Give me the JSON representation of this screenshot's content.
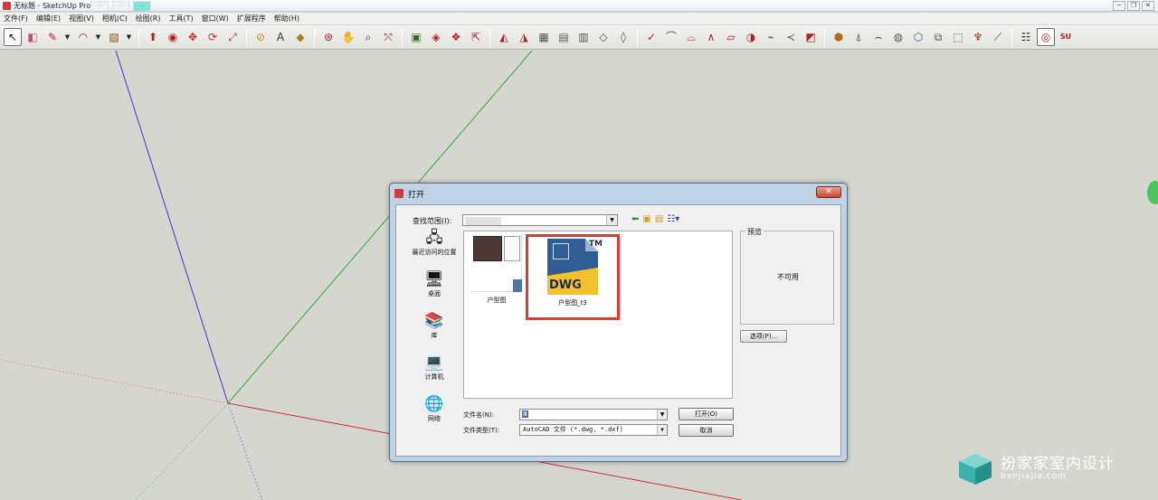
{
  "window": {
    "title": "无标题 - SketchUp Pro",
    "ghost_tabs": [
      "...",
      "...",
      "..."
    ],
    "controls": [
      "─",
      "❐",
      "✕"
    ]
  },
  "menubar": [
    "文件(F)",
    "编辑(E)",
    "视图(V)",
    "相机(C)",
    "绘图(R)",
    "工具(T)",
    "窗口(W)",
    "扩展程序",
    "帮助(H)"
  ],
  "toolbar": {
    "groups": [
      [
        {
          "name": "select",
          "glyph": "↖",
          "color": "#111",
          "active": true
        },
        {
          "name": "eraser",
          "glyph": "◧",
          "color": "#d24b6e"
        },
        {
          "name": "pencil",
          "glyph": "✎",
          "color": "#b32020",
          "drop": true
        },
        {
          "name": "arc",
          "glyph": "◠",
          "color": "#b32020",
          "drop": true
        },
        {
          "name": "rectangle",
          "glyph": "▧",
          "color": "#8a4a2a",
          "drop": true
        }
      ],
      [
        {
          "name": "push-pull",
          "glyph": "⬆",
          "color": "#b32020"
        },
        {
          "name": "follow-me",
          "glyph": "◉",
          "color": "#b32020"
        },
        {
          "name": "move",
          "glyph": "✥",
          "color": "#d02020"
        },
        {
          "name": "rotate",
          "glyph": "⟳",
          "color": "#c03020"
        },
        {
          "name": "scale",
          "glyph": "⤢",
          "color": "#c03020"
        }
      ],
      [
        {
          "name": "tape",
          "glyph": "⊘",
          "color": "#b8902a"
        },
        {
          "name": "text",
          "glyph": "A",
          "color": "#333"
        },
        {
          "name": "paint",
          "glyph": "◆",
          "color": "#b87a20"
        }
      ],
      [
        {
          "name": "orbit",
          "glyph": "⊛",
          "color": "#b32020"
        },
        {
          "name": "pan",
          "glyph": "✋",
          "color": "#333"
        },
        {
          "name": "zoom",
          "glyph": "⌕",
          "color": "#333"
        },
        {
          "name": "zoom-extents",
          "glyph": "⤧",
          "color": "#b32020"
        }
      ],
      [
        {
          "name": "warehouse",
          "glyph": "▣",
          "color": "#3a6a2a"
        },
        {
          "name": "share",
          "glyph": "◈",
          "color": "#b32020"
        },
        {
          "name": "components",
          "glyph": "❖",
          "color": "#b32020"
        },
        {
          "name": "extensions",
          "glyph": "⇱",
          "color": "#b32020"
        }
      ],
      [
        {
          "name": "sandbox-1",
          "glyph": "◭",
          "color": "#b32020"
        },
        {
          "name": "sandbox-2",
          "glyph": "◮",
          "color": "#b32020"
        },
        {
          "name": "sandbox-3",
          "glyph": "▦",
          "color": "#555"
        },
        {
          "name": "sandbox-4",
          "glyph": "▤",
          "color": "#555"
        },
        {
          "name": "sandbox-5",
          "glyph": "▥",
          "color": "#555"
        },
        {
          "name": "sandbox-6",
          "glyph": "◇",
          "color": "#555"
        },
        {
          "name": "sandbox-7",
          "glyph": "◊",
          "color": "#555"
        }
      ],
      [
        {
          "name": "draw-1",
          "glyph": "✓",
          "color": "#b32020"
        },
        {
          "name": "draw-2",
          "glyph": "⌒",
          "color": "#555"
        },
        {
          "name": "draw-3",
          "glyph": "⌓",
          "color": "#b32020"
        },
        {
          "name": "draw-4",
          "glyph": "∧",
          "color": "#b32020"
        },
        {
          "name": "draw-5",
          "glyph": "▱",
          "color": "#b32020"
        },
        {
          "name": "draw-6",
          "glyph": "◑",
          "color": "#b32020"
        },
        {
          "name": "draw-7",
          "glyph": "⌁",
          "color": "#555"
        },
        {
          "name": "draw-8",
          "glyph": "≺",
          "color": "#555"
        },
        {
          "name": "draw-9",
          "glyph": "◩",
          "color": "#b32020"
        }
      ],
      [
        {
          "name": "tool-1",
          "glyph": "⬢",
          "color": "#b86a20"
        },
        {
          "name": "tool-2",
          "glyph": "⍋",
          "color": "#555"
        },
        {
          "name": "tool-3",
          "glyph": "⌢",
          "color": "#333"
        },
        {
          "name": "tool-4",
          "glyph": "◍",
          "color": "#555"
        },
        {
          "name": "tool-5",
          "glyph": "⬡",
          "color": "#3a5a9a"
        },
        {
          "name": "tool-6",
          "glyph": "⧉",
          "color": "#555"
        },
        {
          "name": "tool-7",
          "glyph": "⬚",
          "color": "#555"
        },
        {
          "name": "tool-8",
          "glyph": "♆",
          "color": "#b32020"
        },
        {
          "name": "tool-9",
          "glyph": "⟋",
          "color": "#555"
        }
      ],
      [
        {
          "name": "ext-1",
          "glyph": "☷",
          "color": "#333"
        },
        {
          "name": "ext-2",
          "glyph": "◎",
          "color": "#b32020",
          "active": true
        },
        {
          "name": "ext-3",
          "glyph": "SU",
          "color": "#c02020"
        }
      ]
    ]
  },
  "side_badge": "",
  "dialog": {
    "title": "打开",
    "close": "✕",
    "lookin_label": "查找范围(I):",
    "nav_icons": [
      "⬅",
      "▣",
      "▤",
      "☷▾"
    ],
    "places": [
      {
        "icon": "🖧",
        "label": "最近访问的位置"
      },
      {
        "icon": "🖥",
        "label": "桌面"
      },
      {
        "icon": "📚",
        "label": "库"
      },
      {
        "icon": "💻",
        "label": "计算机"
      },
      {
        "icon": "🌐",
        "label": "网络"
      }
    ],
    "files": [
      {
        "label": "户型图"
      },
      {
        "label": "户型图_t3",
        "icon_text": "DWG",
        "tm": "TM"
      }
    ],
    "preview_label": "预览",
    "preview_text": "不可用",
    "options_label": "选项(P)...",
    "filename_label": "文件名(N):",
    "filename_value": "Ⅲ",
    "filetype_label": "文件类型(T):",
    "filetype_value": "AutoCAD 文件 (*.dwg, *.dxf)",
    "open_label": "打开(O)",
    "cancel_label": "取消"
  },
  "watermark": {
    "name": "扮家家室内设计",
    "url": "banjiajia.com"
  },
  "colors": {
    "axis_blue": "#3a3ad0",
    "axis_green": "#3aa83a",
    "axis_red": "#c83232",
    "highlight": "#e13838"
  }
}
